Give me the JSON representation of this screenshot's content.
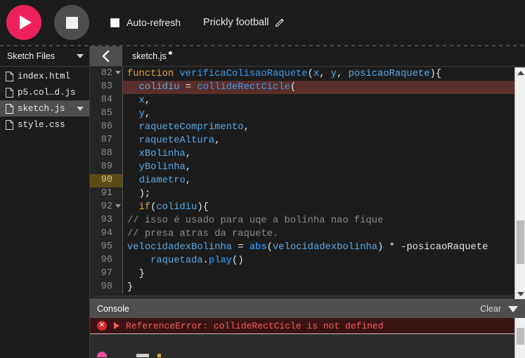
{
  "toolbar": {
    "play_label": "play-button",
    "stop_label": "stop-button",
    "autorefresh_label": "Auto-refresh",
    "autorefresh_checked": false,
    "sketch_name": "Prickly football",
    "edit_icon": "pencil-icon"
  },
  "sidebar": {
    "title": "Sketch Files",
    "files": [
      {
        "name": "index.html",
        "selected": false,
        "has_menu": false
      },
      {
        "name": "p5.col…d.js",
        "selected": false,
        "has_menu": false
      },
      {
        "name": "sketch.js",
        "selected": true,
        "has_menu": true
      },
      {
        "name": "style.css",
        "selected": false,
        "has_menu": false
      }
    ]
  },
  "editor": {
    "collapse_icon": "chevron-left-icon",
    "tab_name": "sketch.js",
    "unsaved": true,
    "lines": [
      {
        "n": "82",
        "fold": true,
        "state": "normal",
        "tokens": [
          {
            "t": "function ",
            "c": "kw"
          },
          {
            "t": "verificaColisaoRaquete",
            "c": "fn"
          },
          {
            "t": "(",
            "c": "pun"
          },
          {
            "t": "x",
            "c": "var"
          },
          {
            "t": ", ",
            "c": "pun"
          },
          {
            "t": "y",
            "c": "var"
          },
          {
            "t": ", ",
            "c": "pun"
          },
          {
            "t": "posicaoRaquete",
            "c": "var"
          },
          {
            "t": "){",
            "c": "pun"
          }
        ]
      },
      {
        "n": "83",
        "fold": false,
        "state": "error",
        "tokens": [
          {
            "t": "  ",
            "c": "pun"
          },
          {
            "t": "colidiu",
            "c": "var"
          },
          {
            "t": " = ",
            "c": "pun"
          },
          {
            "t": "collideRectCicle",
            "c": "fn"
          },
          {
            "t": "(",
            "c": "pun"
          }
        ]
      },
      {
        "n": "84",
        "fold": false,
        "state": "normal",
        "tokens": [
          {
            "t": "  ",
            "c": "pun"
          },
          {
            "t": "x",
            "c": "var"
          },
          {
            "t": ",",
            "c": "pun"
          }
        ]
      },
      {
        "n": "85",
        "fold": false,
        "state": "normal",
        "tokens": [
          {
            "t": "  ",
            "c": "pun"
          },
          {
            "t": "y",
            "c": "var"
          },
          {
            "t": ",",
            "c": "pun"
          }
        ]
      },
      {
        "n": "86",
        "fold": false,
        "state": "normal",
        "tokens": [
          {
            "t": "  ",
            "c": "pun"
          },
          {
            "t": "raqueteComprimento",
            "c": "var"
          },
          {
            "t": ",",
            "c": "pun"
          }
        ]
      },
      {
        "n": "87",
        "fold": false,
        "state": "normal",
        "tokens": [
          {
            "t": "  ",
            "c": "pun"
          },
          {
            "t": "raqueteAltura",
            "c": "var"
          },
          {
            "t": ",",
            "c": "pun"
          }
        ]
      },
      {
        "n": "88",
        "fold": false,
        "state": "normal",
        "tokens": [
          {
            "t": "  ",
            "c": "pun"
          },
          {
            "t": "xBolinha",
            "c": "var"
          },
          {
            "t": ",",
            "c": "pun"
          }
        ]
      },
      {
        "n": "89",
        "fold": false,
        "state": "normal",
        "tokens": [
          {
            "t": "  ",
            "c": "pun"
          },
          {
            "t": "yBolinha",
            "c": "var"
          },
          {
            "t": ",",
            "c": "pun"
          }
        ]
      },
      {
        "n": "90",
        "fold": false,
        "state": "cursor",
        "tokens": [
          {
            "t": "  ",
            "c": "pun"
          },
          {
            "t": "diametro",
            "c": "var"
          },
          {
            "t": ",",
            "c": "pun"
          }
        ]
      },
      {
        "n": "91",
        "fold": false,
        "state": "normal",
        "tokens": [
          {
            "t": "  );",
            "c": "pun"
          }
        ]
      },
      {
        "n": "92",
        "fold": true,
        "state": "normal",
        "tokens": [
          {
            "t": "  ",
            "c": "pun"
          },
          {
            "t": "if",
            "c": "kw"
          },
          {
            "t": "(",
            "c": "pun"
          },
          {
            "t": "colidiu",
            "c": "var"
          },
          {
            "t": "){",
            "c": "pun"
          }
        ]
      },
      {
        "n": "93",
        "fold": false,
        "state": "normal",
        "tokens": [
          {
            "t": "// isso é usado para uqe a bolinha nao fique",
            "c": "cmt"
          }
        ]
      },
      {
        "n": "94",
        "fold": false,
        "state": "normal",
        "tokens": [
          {
            "t": "// presa atras da raquete.",
            "c": "cmt"
          }
        ]
      },
      {
        "n": "95",
        "fold": false,
        "state": "normal",
        "tokens": [
          {
            "t": "velocidadexBolinha",
            "c": "var"
          },
          {
            "t": " = ",
            "c": "pun"
          },
          {
            "t": "abs",
            "c": "bfn"
          },
          {
            "t": "(",
            "c": "pun"
          },
          {
            "t": "velocidadexbolinha",
            "c": "var"
          },
          {
            "t": ") * -",
            "c": "pun"
          },
          {
            "t": "posicaoRaquete",
            "c": "pun"
          }
        ]
      },
      {
        "n": "96",
        "fold": false,
        "state": "normal",
        "tokens": [
          {
            "t": "    ",
            "c": "pun"
          },
          {
            "t": "raquetada",
            "c": "var"
          },
          {
            "t": ".",
            "c": "pun"
          },
          {
            "t": "play",
            "c": "bfn"
          },
          {
            "t": "()",
            "c": "pun"
          }
        ]
      },
      {
        "n": "97",
        "fold": false,
        "state": "normal",
        "tokens": [
          {
            "t": "  }",
            "c": "pun"
          }
        ]
      },
      {
        "n": "98",
        "fold": false,
        "state": "normal",
        "tokens": [
          {
            "t": "}",
            "c": "pun"
          }
        ]
      }
    ]
  },
  "console": {
    "title": "Console",
    "clear_label": "Clear",
    "collapse_icon": "chevron-down-icon",
    "messages": [
      {
        "level": "error",
        "icon": "error-circle-icon",
        "expand_icon": "triangle-right-icon",
        "text": "ReferenceError: collideRectCicle is not defined"
      }
    ]
  },
  "colors": {
    "accent_pink": "#ed225d",
    "error_red": "#f25c5c",
    "error_line_bg": "#5a2e2b",
    "cursor_line_bg": "#5b4b15",
    "panel_bg": "#1c1c1c",
    "gutter_bg": "#252525",
    "header_gray": "#4e4e4e"
  }
}
